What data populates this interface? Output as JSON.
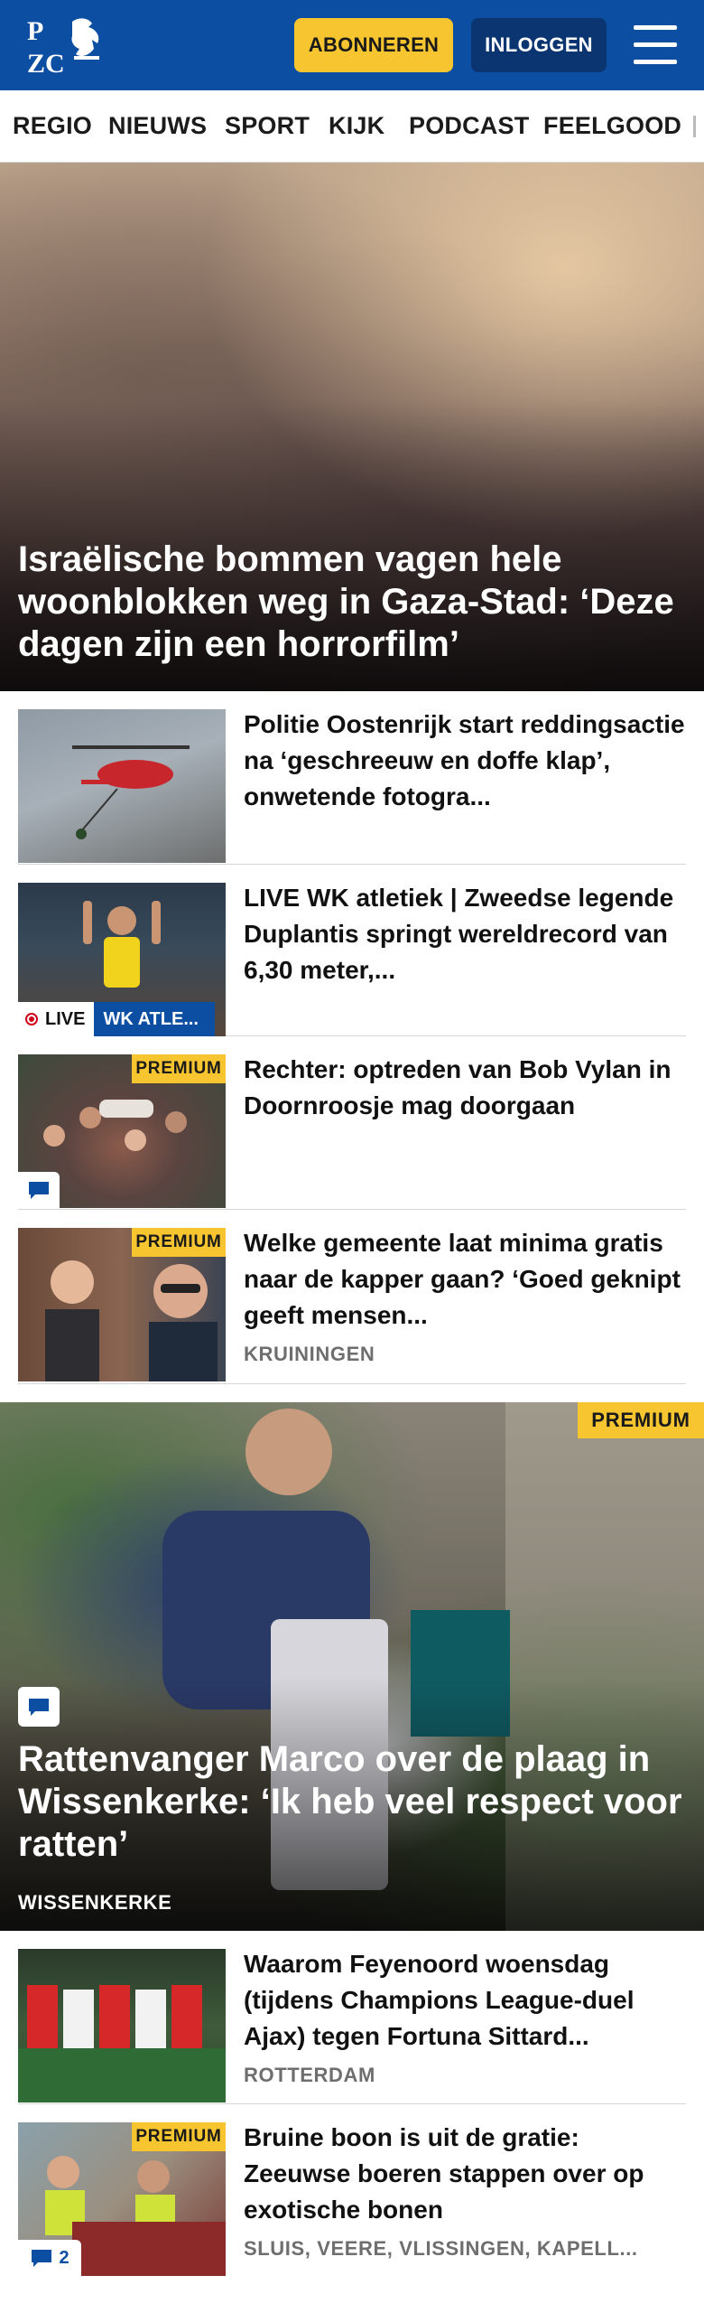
{
  "header": {
    "logo_text": "PZC",
    "subscribe_label": "ABONNEREN",
    "login_label": "INLOGGEN",
    "brand_color": "#0b4ea2",
    "accent_color": "#f7c52f"
  },
  "nav": {
    "items": [
      "REGIO",
      "NIEUWS",
      "SPORT",
      "KIJK",
      "PODCAST",
      "FEELGOOD"
    ]
  },
  "hero": {
    "title": "Israëlische bommen vagen hele woonblokken weg in Gaza-Stad: ‘Deze dagen zijn een horrorfilm’"
  },
  "articles": [
    {
      "title": "Politie Oostenrijk start reddingsactie na ‘geschreeuw en doffe klap’, onwetende fotogra..."
    },
    {
      "title": "LIVE WK atletiek | Zweedse legende Duplantis springt wereldrecord van 6,30 meter,...",
      "live_label": "LIVE",
      "category_label": "WK ATLE..."
    },
    {
      "title": "Rechter: optreden van Bob Vylan in Doornroosje mag doorgaan",
      "premium_label": "PREMIUM"
    },
    {
      "title": "Welke gemeente laat minima gratis naar de kapper gaan? ‘Goed geknipt geeft mensen...",
      "premium_label": "PREMIUM",
      "location": "KRUININGEN"
    }
  ],
  "feature": {
    "premium_label": "PREMIUM",
    "title": "Rattenvanger Marco over de plaag in Wissenkerke: ‘Ik heb veel respect voor ratten’",
    "location": "WISSENKERKE"
  },
  "more_articles": [
    {
      "title": "Waarom Feyenoord woensdag (tijdens Champions League-duel Ajax) tegen Fortuna Sittard...",
      "location": "ROTTERDAM"
    },
    {
      "title": "Bruine boon is uit de gratie: Zeeuwse boeren stappen over op exotische bonen",
      "premium_label": "PREMIUM",
      "location": "SLUIS, VEERE, VLISSINGEN, KAPELL...",
      "comment_count": "2"
    }
  ]
}
